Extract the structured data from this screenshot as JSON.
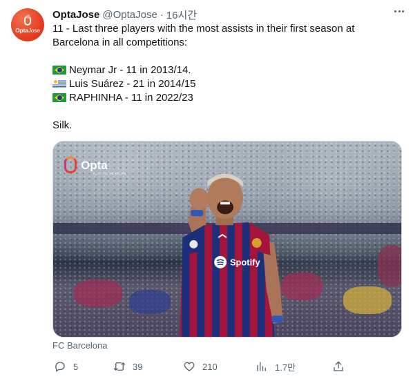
{
  "tweet": {
    "avatar": {
      "brand": "Opta",
      "suffix": "Jose"
    },
    "author_name": "OptaJose",
    "handle": "@OptaJose",
    "separator": "·",
    "time": "16시간",
    "lines": [
      "11 - Last three players with the most assists in their first season at",
      "Barcelona in all competitions:"
    ],
    "list": [
      {
        "flag": "brazil-flag",
        "text": "Neymar Jr - 11 in 2013/14."
      },
      {
        "flag": "uruguay-flag",
        "text": "Luis Suárez - 21 in 2014/15"
      },
      {
        "flag": "brazil-flag",
        "text": "RAPHINHA - 11 in 2022/23"
      }
    ],
    "closing": "Silk.",
    "media": {
      "logo_text": "Opta",
      "logo_subtext": "by STATS PERFORM",
      "shirt_sponsor": "Spotify",
      "colors": {
        "shirt_red": "#a5143a",
        "shirt_blue": "#1c2f7a"
      }
    },
    "caption": "FC Barcelona",
    "actions": {
      "replies": "5",
      "retweets": "39",
      "likes": "210",
      "views": "1.7만"
    }
  },
  "colors": {
    "text": "#0f1419",
    "secondary": "#536471",
    "border": "#cfd9de",
    "brand_orange": "#e3371f"
  }
}
